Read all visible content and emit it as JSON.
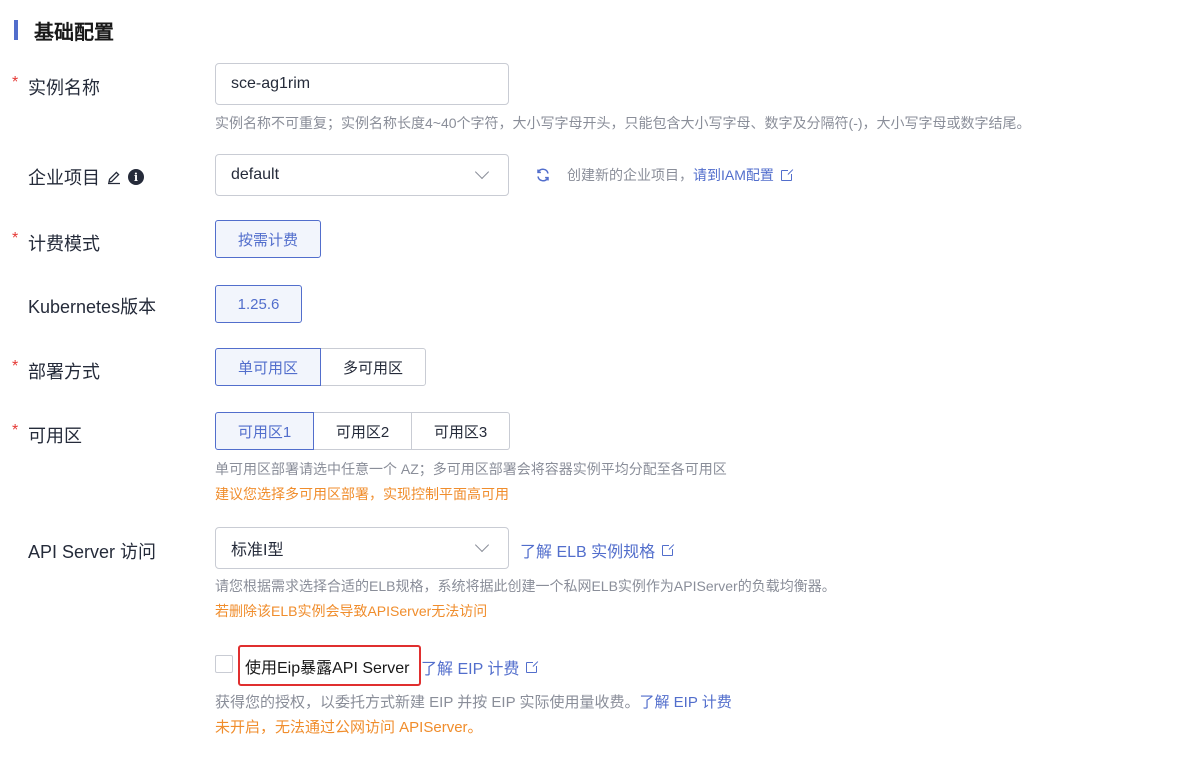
{
  "section_title": "基础配置",
  "instance_name": {
    "label": "实例名称",
    "value": "sce-ag1rim",
    "hint": "实例名称不可重复；实例名称长度4~40个字符，大小写字母开头，只能包含大小写字母、数字及分隔符(-)，大小写字母或数字结尾。"
  },
  "enterprise_project": {
    "label": "企业项目",
    "value": "default",
    "create_text": "创建新的企业项目，",
    "iam_link": "请到IAM配置"
  },
  "billing": {
    "label": "计费模式",
    "option": "按需计费"
  },
  "kubernetes": {
    "label": "Kubernetes版本",
    "option": "1.25.6"
  },
  "deploy": {
    "label": "部署方式",
    "options": [
      "单可用区",
      "多可用区"
    ],
    "selected": "单可用区"
  },
  "az": {
    "label": "可用区",
    "options": [
      "可用区1",
      "可用区2",
      "可用区3"
    ],
    "selected": "可用区1",
    "hint": "单可用区部署请选中任意一个 AZ；多可用区部署会将容器实例平均分配至各可用区",
    "warning": "建议您选择多可用区部署，实现控制平面高可用"
  },
  "api_server": {
    "label": "API Server 访问",
    "value": "标准I型",
    "link": "了解 ELB 实例规格",
    "hint": "请您根据需求选择合适的ELB规格，系统将据此创建一个私网ELB实例作为APIServer的负载均衡器。",
    "warning": "若删除该ELB实例会导致APIServer无法访问"
  },
  "eip": {
    "checkbox_label": "使用Eip暴露API Server",
    "checked": false,
    "link": "了解 EIP 计费",
    "hint": "获得您的授权，以委托方式新建 EIP 并按 EIP 实际使用量收费。",
    "hint_link": "了解 EIP 计费",
    "warning": "未开启，无法通过公网访问 APIServer。"
  },
  "colors": {
    "accent": "#526ecc",
    "warning": "#f08d2c",
    "required": "#e53935",
    "highlight": "#e02f2f"
  }
}
